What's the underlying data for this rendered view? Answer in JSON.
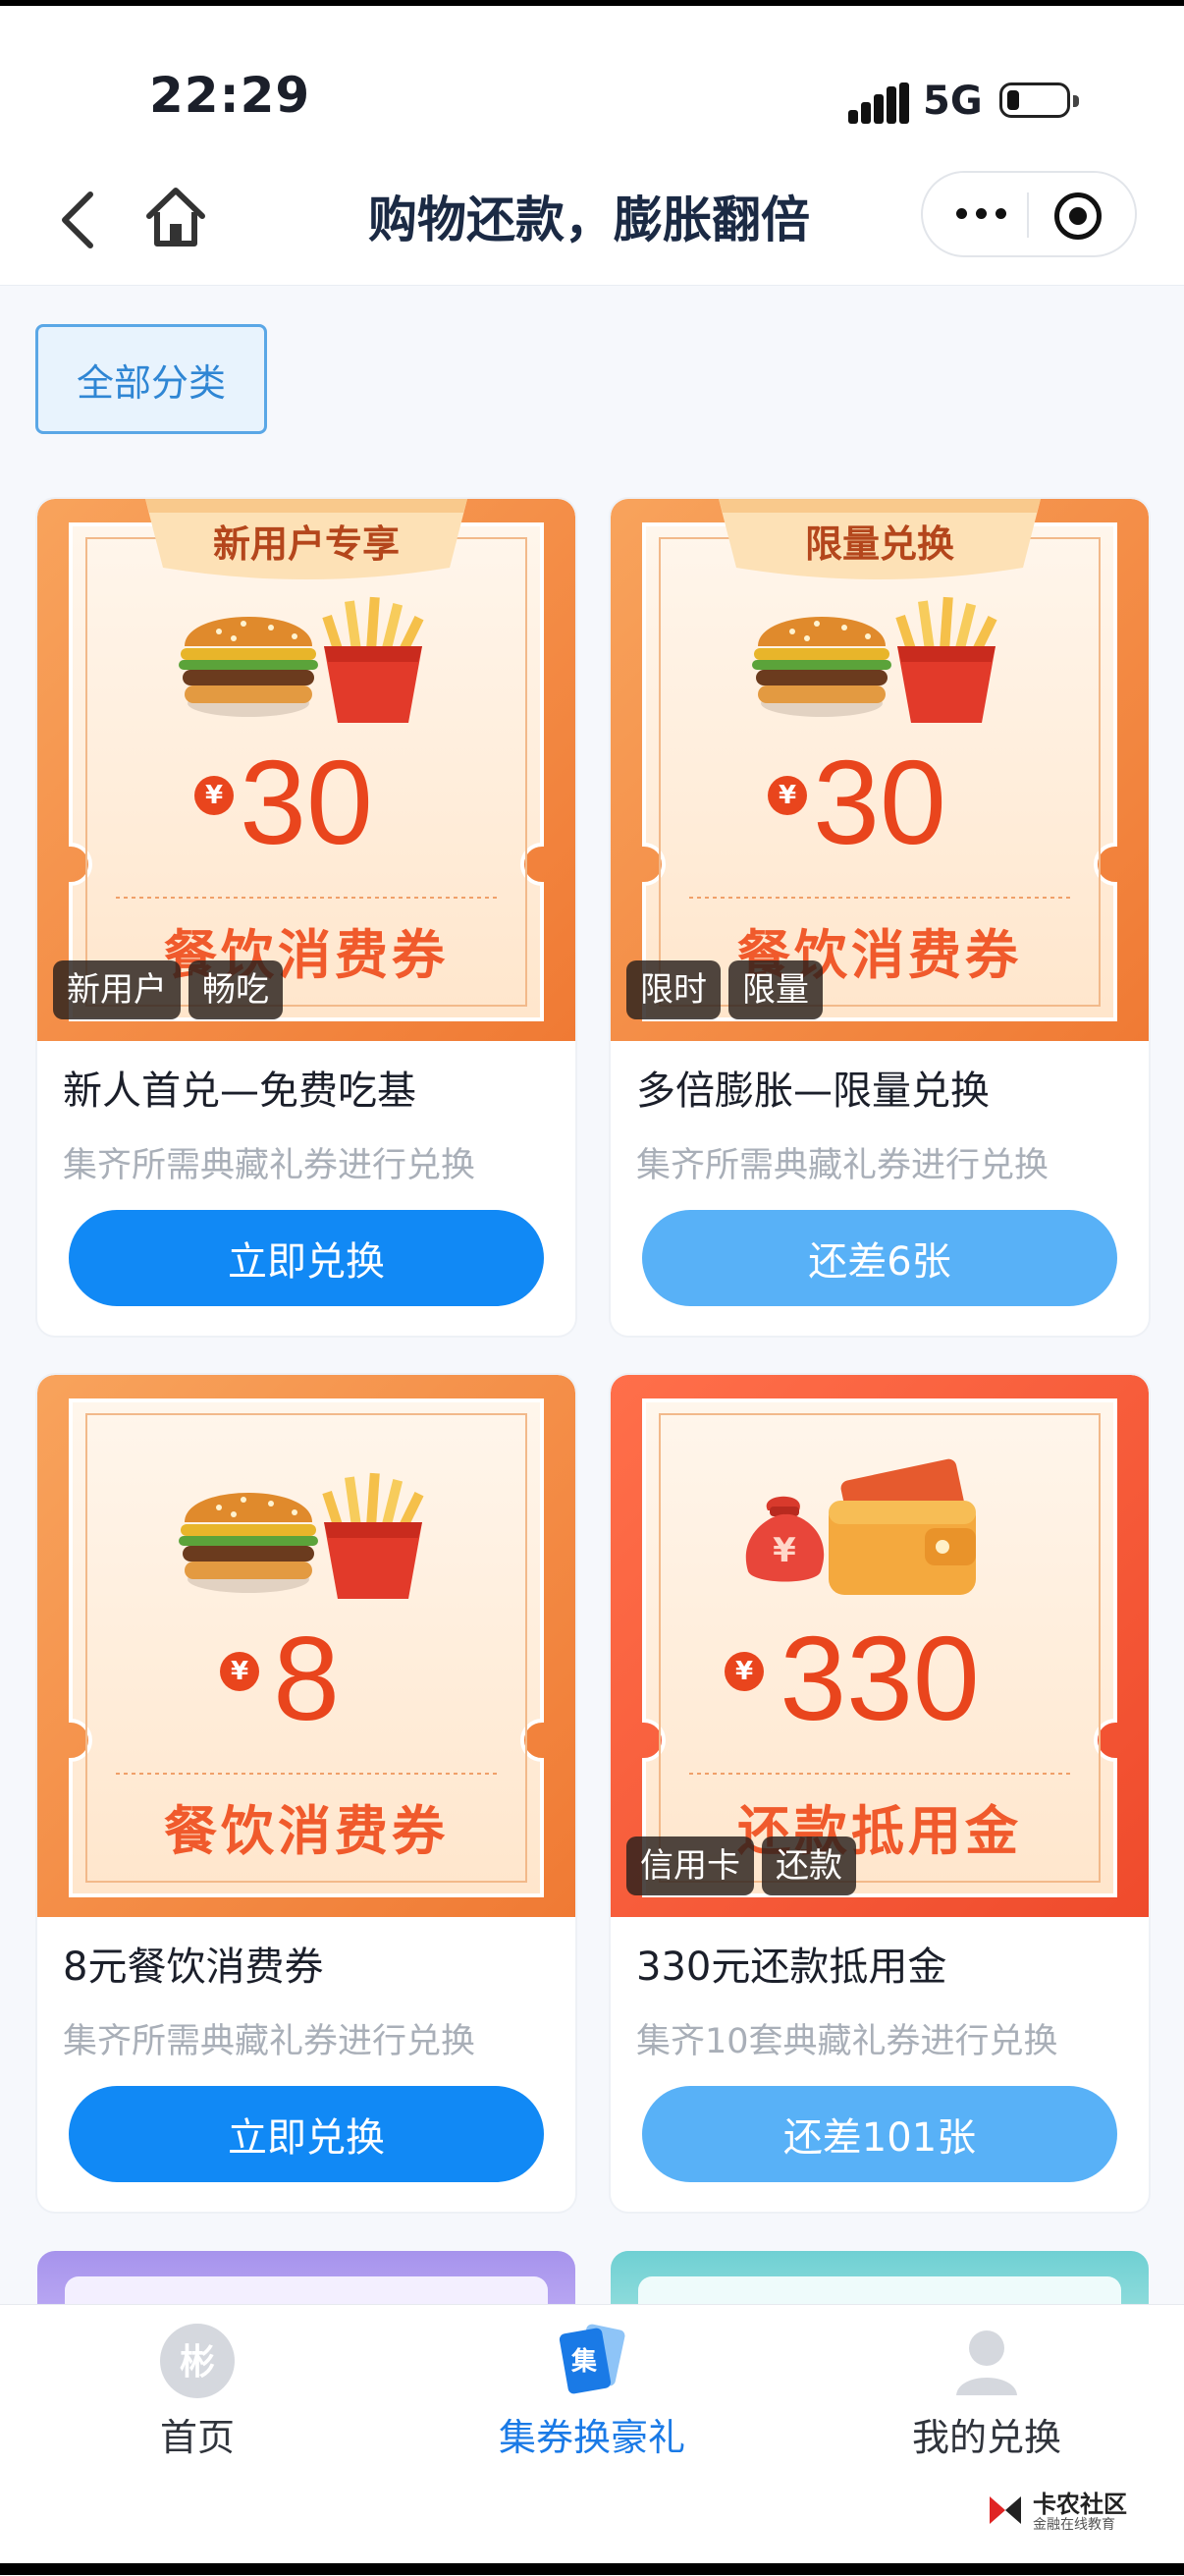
{
  "status": {
    "time": "22:29",
    "network": "5G"
  },
  "nav": {
    "title": "购物还款，膨胀翻倍"
  },
  "filter": {
    "label": "全部分类"
  },
  "cards": [
    {
      "ribbon": "新用户专享",
      "amount": "30",
      "currency": "¥",
      "voucher": "餐饮消费券",
      "tags": [
        "新用户",
        "畅吃"
      ],
      "name": "新人首兑—免费吃基",
      "desc": "集齐所需典藏礼券进行兑换",
      "action": "立即兑换",
      "image": "burger-fries"
    },
    {
      "ribbon": "限量兑换",
      "amount": "30",
      "currency": "¥",
      "voucher": "餐饮消费券",
      "tags": [
        "限时",
        "限量"
      ],
      "name": "多倍膨胀—限量兑换",
      "desc": "集齐所需典藏礼券进行兑换",
      "action": "还差6张",
      "image": "burger-fries"
    },
    {
      "ribbon": "",
      "amount": "8",
      "currency": "¥",
      "voucher": "餐饮消费券",
      "tags": [],
      "name": "8元餐饮消费券",
      "desc": "集齐所需典藏礼券进行兑换",
      "action": "立即兑换",
      "image": "burger-fries"
    },
    {
      "ribbon": "",
      "amount": "330",
      "currency": "¥",
      "voucher": "还款抵用金",
      "tags": [
        "信用卡",
        "还款"
      ],
      "name": "330元还款抵用金",
      "desc": "集齐10套典藏礼券进行兑换",
      "action": "还差101张",
      "image": "wallet-moneybag"
    }
  ],
  "tabs": [
    {
      "label": "首页",
      "icon": "home-logo-icon"
    },
    {
      "label": "集券换豪礼",
      "icon": "coupon-collect-icon"
    },
    {
      "label": "我的兑换",
      "icon": "user-icon"
    }
  ],
  "watermark": {
    "title": "卡农社区",
    "subtitle": "金融在线教育"
  },
  "colors": {
    "primary": "#1189f5",
    "secondary": "#58b1f7",
    "accent_orange": "#f27a33",
    "active_tab": "#1a7ae6"
  }
}
